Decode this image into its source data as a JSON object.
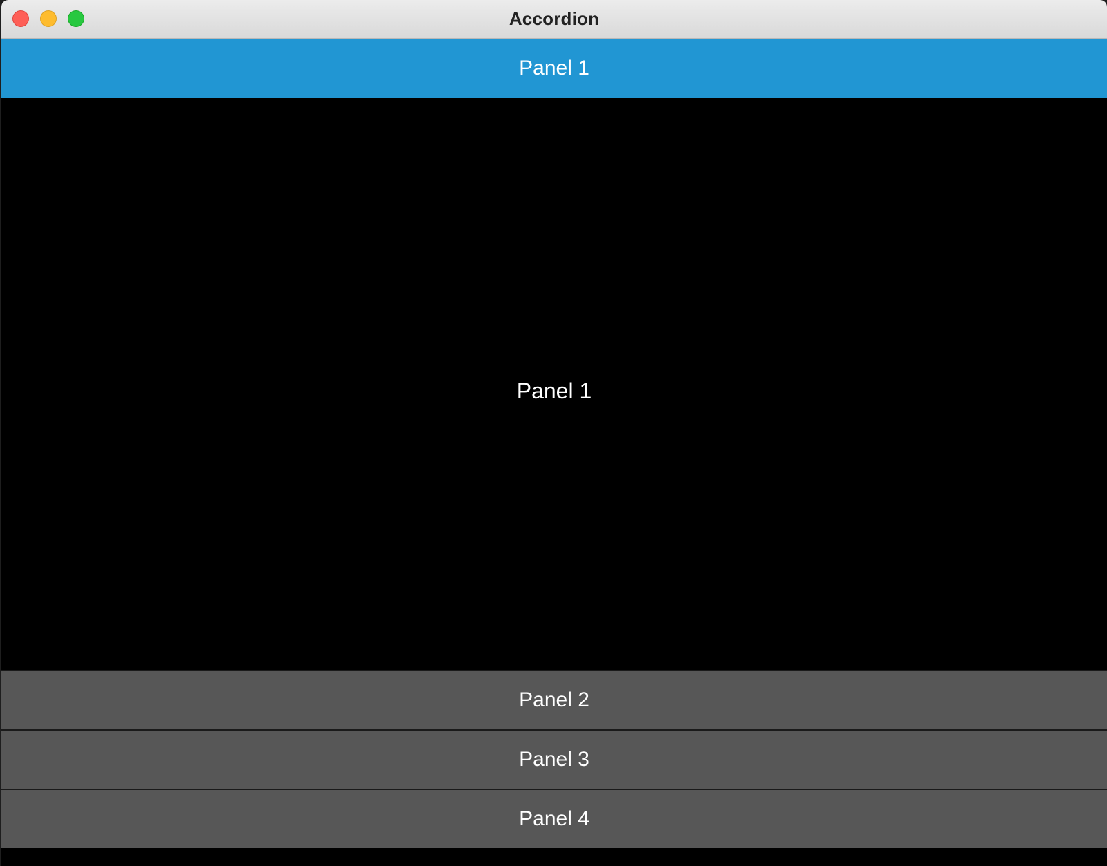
{
  "window": {
    "title": "Accordion"
  },
  "accordion": {
    "panels": [
      {
        "label": "Panel 1",
        "expanded": true,
        "content": "Panel 1"
      },
      {
        "label": "Panel 2",
        "expanded": false
      },
      {
        "label": "Panel 3",
        "expanded": false
      },
      {
        "label": "Panel 4",
        "expanded": false
      }
    ]
  },
  "colors": {
    "active_header": "#2196d3",
    "collapsed_header": "#575757",
    "content_background": "#000000"
  }
}
